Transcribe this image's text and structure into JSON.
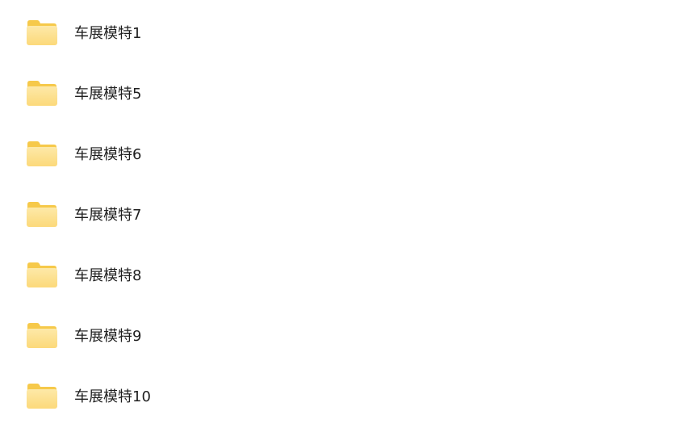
{
  "folders": [
    {
      "name": "车展模特1",
      "icon": "folder-icon"
    },
    {
      "name": "车展模特5",
      "icon": "folder-icon"
    },
    {
      "name": "车展模特6",
      "icon": "folder-icon"
    },
    {
      "name": "车展模特7",
      "icon": "folder-icon"
    },
    {
      "name": "车展模特8",
      "icon": "folder-icon"
    },
    {
      "name": "车展模特9",
      "icon": "folder-icon"
    },
    {
      "name": "车展模特10",
      "icon": "folder-icon"
    }
  ],
  "colors": {
    "folder_back": "#f6c94a",
    "folder_front_top": "#fde9a8",
    "folder_front_bottom": "#fcd97a",
    "text": "#1f1f1f",
    "background": "#ffffff"
  }
}
